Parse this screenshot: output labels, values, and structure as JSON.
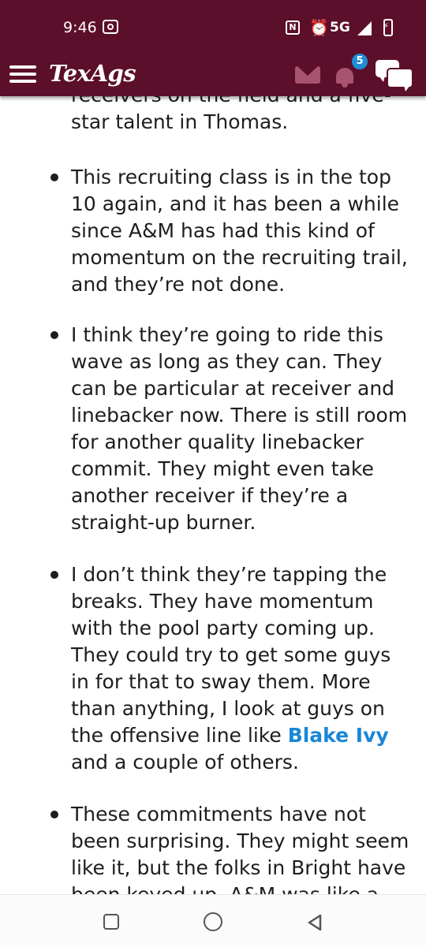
{
  "status_bar": {
    "time": "9:46",
    "network": "5G"
  },
  "app_bar": {
    "logo": "TexAgs",
    "notification_count": "5"
  },
  "article": {
    "continued_line_1": "receivers on the field and a five-",
    "continued_line_2": "star talent in Thomas.",
    "bullets": [
      "This recruiting class is in the top 10 again, and it has been a while since A&M has had this kind of momentum on the recruiting trail, and they’re not done.",
      "I think they’re going to ride this wave as long as they can. They can be particular at receiver and linebacker now. There is still room for another quality linebacker commit. They might even take another receiver if they’re a straight-up burner.",
      {
        "before": "I don’t think they’re tapping the breaks. They have momentum with the pool party coming up. They could try to get some guys in for that to sway them. More than anything, I look at guys on the offensive line like ",
        "link": "Blake Ivy",
        "after": " and a couple of others."
      },
      "These commitments have not been surprising. They might seem like it, but the folks in Bright have been keyed up. A&M was like a"
    ]
  },
  "colors": {
    "brand": "#5c0f2a",
    "link": "#1a86d6",
    "badge": "#1e8fd6"
  }
}
